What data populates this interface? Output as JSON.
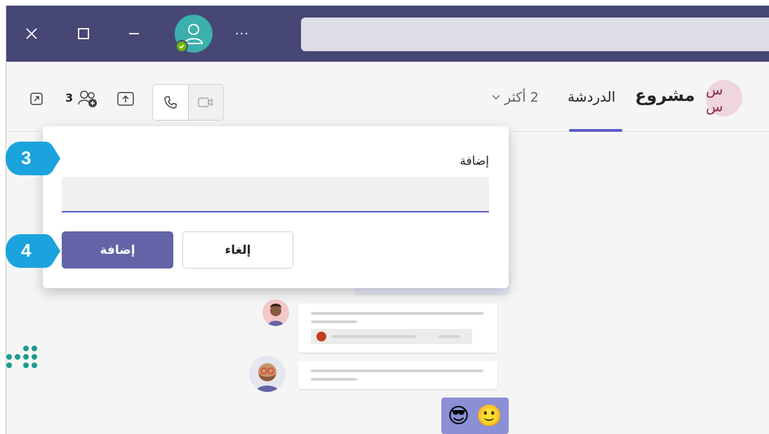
{
  "titlebar": {
    "close_icon": "close-icon",
    "maximize_icon": "maximize-icon",
    "minimize_icon": "minimize-icon",
    "more_label": "···",
    "bg_color": "#464775"
  },
  "header": {
    "group_initials": "س س",
    "title": "مشروع",
    "tab_chat": "الدردشة",
    "more_tabs": "2 أكثر",
    "people_count": "3",
    "accent_color": "#5b5fc7"
  },
  "dialog": {
    "label": "إضافة",
    "input_value": "",
    "add_button": "إضافة",
    "cancel_button": "إلغاء"
  },
  "steps": {
    "step3": "3",
    "step4": "4",
    "badge_color": "#1ba3dd"
  },
  "chat": {
    "emoji_message": "😎 🙂",
    "attachment_icon": "powerpoint-icon"
  }
}
